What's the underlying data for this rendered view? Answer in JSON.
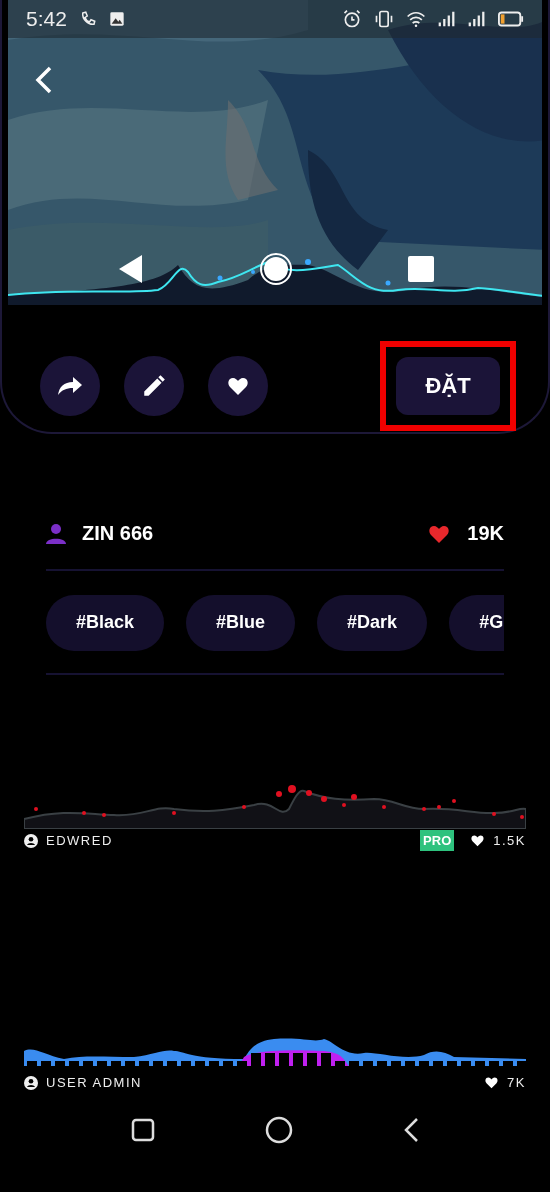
{
  "status_bar": {
    "time": "5:42"
  },
  "actions": {
    "set_button": {
      "label": "ĐẶT",
      "highlighted": true
    }
  },
  "author": {
    "name": "ZIN 666",
    "likes": "19K"
  },
  "tags": [
    "#Black",
    "#Blue",
    "#Dark",
    "#G"
  ],
  "wallpapers": [
    {
      "kind": "dots",
      "author": "EDWRED",
      "badge": "PRO",
      "likes": "1.5K"
    },
    {
      "kind": "bars",
      "author": "USER ADMIN",
      "likes": "7K"
    }
  ]
}
